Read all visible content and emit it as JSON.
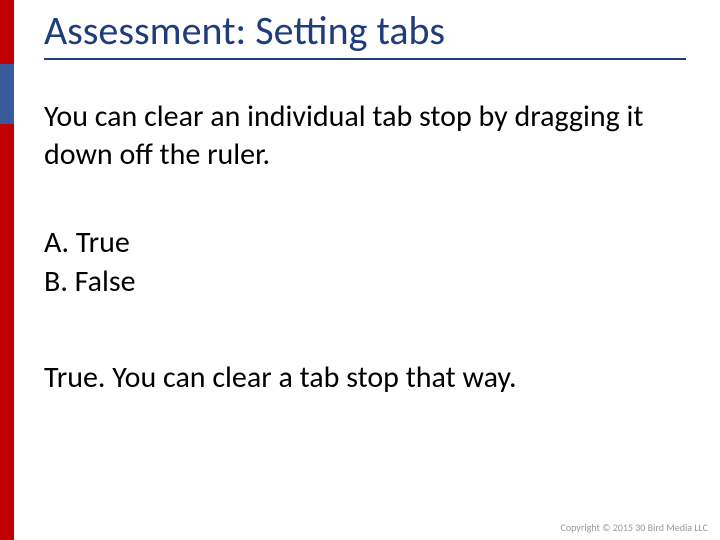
{
  "slide": {
    "title": "Assessment: Setting tabs",
    "question": "You can clear an individual tab stop by dragging it down off the ruler.",
    "options": {
      "a": "A. True",
      "b": "B. False"
    },
    "answer": "True. You can clear a tab stop that way.",
    "copyright": "Copyright © 2015 30 Bird Media LLC"
  }
}
